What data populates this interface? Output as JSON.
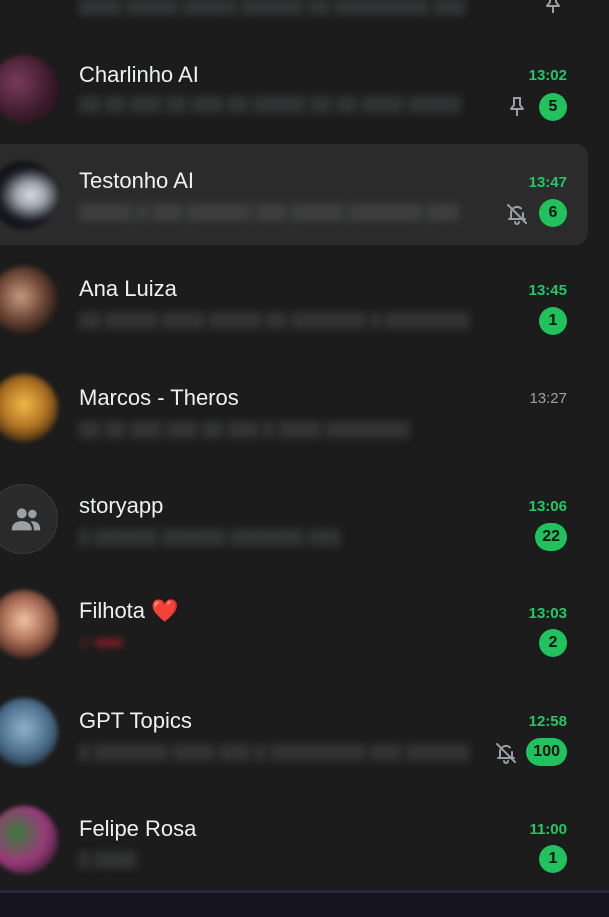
{
  "chats": [
    {
      "name": "Charlinho AI",
      "time": "13:02",
      "unread": "5",
      "icon": "pin-icon"
    },
    {
      "name": "Testonho AI",
      "time": "13:47",
      "unread": "6",
      "icon": "muted-bell-icon",
      "selected": true
    },
    {
      "name": "Ana Luiza",
      "time": "13:45",
      "unread": "1"
    },
    {
      "name": "Marcos - Theros",
      "time": "13:27"
    },
    {
      "name": "storyapp",
      "time": "13:06",
      "unread": "22"
    },
    {
      "name": "Filhota",
      "emoji": "❤️",
      "time": "13:03",
      "unread": "2"
    },
    {
      "name": "GPT Topics",
      "time": "12:58",
      "unread": "100",
      "icon": "muted-bell-icon"
    },
    {
      "name": "Felipe Rosa",
      "time": "11:00",
      "unread": "1"
    }
  ],
  "colors": {
    "background": "#1c1c1c",
    "selected_row": "#2b2b2b",
    "unread_time": "#25c766",
    "badge": "#21c25e",
    "read_time": "#9aa0a4"
  }
}
